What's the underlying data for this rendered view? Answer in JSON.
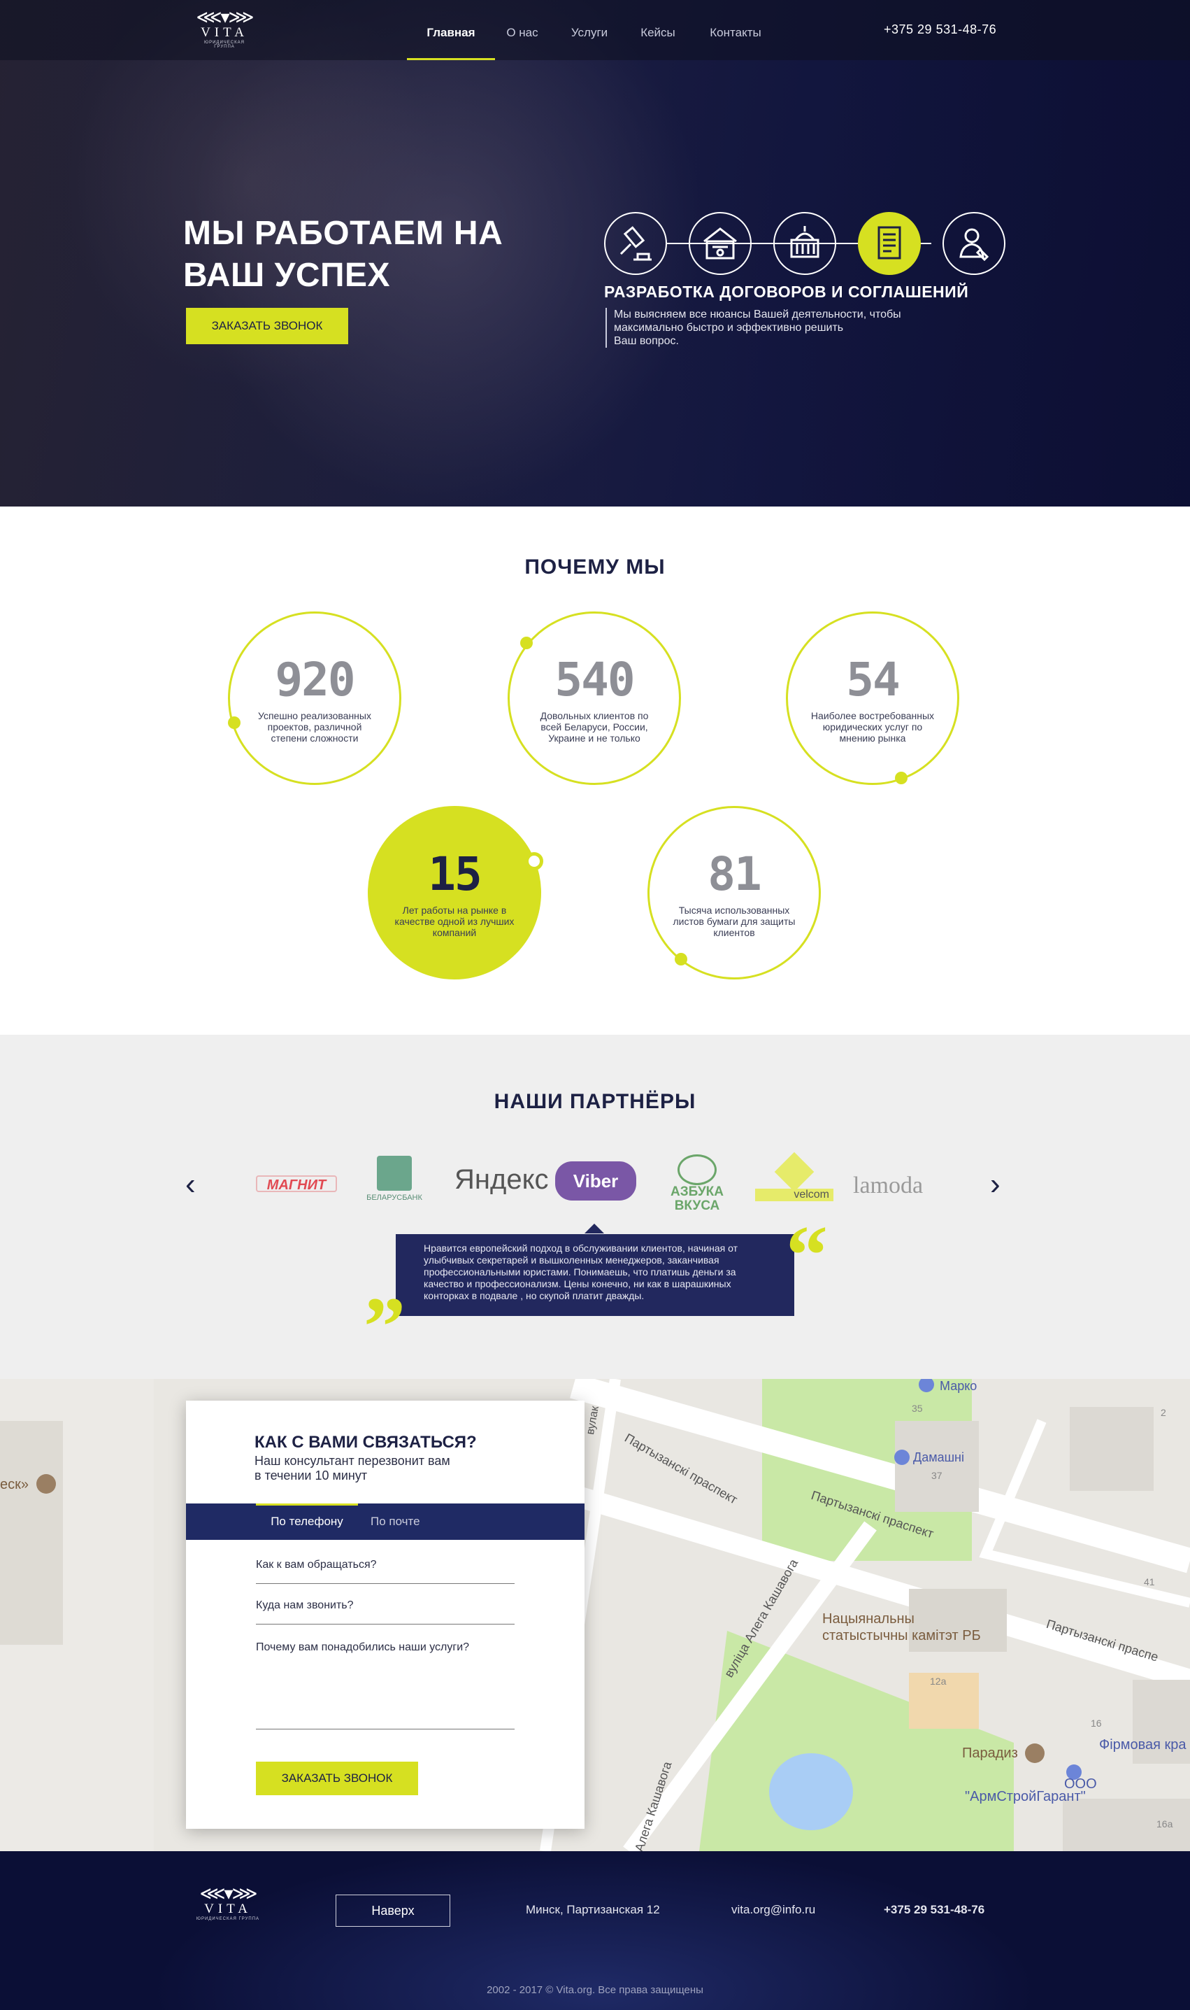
{
  "brand": {
    "name": "VITA",
    "tagline": "ЮРИДИЧЕСКАЯ ГРУППА"
  },
  "nav": {
    "items": [
      {
        "label": "Главная",
        "active": true
      },
      {
        "label": "О нас"
      },
      {
        "label": "Услуги"
      },
      {
        "label": "Кейсы"
      },
      {
        "label": "Контакты"
      }
    ],
    "phone": "+375 29 531-48-76"
  },
  "hero": {
    "title_line1": "МЫ РАБОТАЕМ НА",
    "title_line2": "ВАШ УСПЕХ",
    "cta": "ЗАКАЗАТЬ ЗВОНОК",
    "services": [
      {
        "icon": "gavel-icon"
      },
      {
        "icon": "court-building-icon"
      },
      {
        "icon": "government-building-icon"
      },
      {
        "icon": "document-icon",
        "active": true
      },
      {
        "icon": "lawyer-icon"
      }
    ],
    "service_title": "РАЗРАБОТКА ДОГОВОРОВ И СОГЛАШЕНИЙ",
    "service_desc": [
      "Мы выясняем все нюансы Вашей деятельности, чтобы",
      "максимально быстро и эффективно решить",
      "Ваш вопрос."
    ]
  },
  "why": {
    "title": "ПОЧЕМУ МЫ",
    "stats": [
      {
        "num": "920",
        "text": "Успешно реализованных проектов, различной степени сложности"
      },
      {
        "num": "540",
        "text": "Довольных клиентов по всей Беларуси, России, Украине и не только"
      },
      {
        "num": "54",
        "text": "Наиболее востребованных юридических услуг по мнению рынка"
      },
      {
        "num": "15",
        "text": "Лет работы на рынке в качестве одной из лучших компаний"
      },
      {
        "num": "81",
        "text": "Тысяча использованных листов бумаги для защиты клиентов"
      }
    ]
  },
  "partners": {
    "title": "НАШИ ПАРТНЁРЫ",
    "logos": [
      "МАГНИТ",
      "БЕЛАРУСБАНК",
      "Яндекс",
      "Viber",
      "АЗБУКА ВКУСА",
      "velcom",
      "lamoda"
    ],
    "quote": "Нравится европейский подход в обслуживании клиентов, начиная от улыбчивых секретарей и вышколенных менеджеров, заканчивая профессиональными юристами. Понимаешь, что платишь деньги за качество и профессионализм. Цены конечно, ни как в шарашкиных конторках в подвале , но скупой платит дважды."
  },
  "contact": {
    "title": "КАК С ВАМИ СВЯЗАТЬСЯ?",
    "subtitle_line1": "Наш консультант перезвонит вам",
    "subtitle_line2": "в течении 10 минут",
    "tabs": [
      {
        "label": "По телефону",
        "active": true
      },
      {
        "label": "По почте"
      }
    ],
    "fields": [
      "Как к вам обращаться?",
      "Куда нам звонить?",
      "Почему вам понадобились наши услуги?"
    ],
    "submit": "ЗАКАЗАТЬ ЗВОНОК"
  },
  "map": {
    "labels": [
      "Марко",
      "Дамашні",
      "Партызанскі праспект",
      "Партызанскі праспект",
      "Партызанскі праспе",
      "вуліца Алега Кашавога",
      "Алега Кашавога",
      "Нацыянальны",
      "статыстычны камітэт РБ",
      "Парадиз",
      "Фірмовая кра",
      "ООО",
      "\"АрмСтройГарант\"",
      "еск»",
      "вулак",
      "35",
      "37",
      "41",
      "12а",
      "16",
      "16а",
      "2"
    ]
  },
  "footer": {
    "up": "Наверх",
    "address": "Минск, Партизанская 12",
    "email": "vita.org@info.ru",
    "phone": "+375 29 531-48-76",
    "copyright": "2002 - 2017  ©  Vita.org. Все права защищены"
  },
  "colors": {
    "accent": "#d6e021",
    "navy": "#1d2144",
    "tab_bar": "#1f2a64"
  }
}
